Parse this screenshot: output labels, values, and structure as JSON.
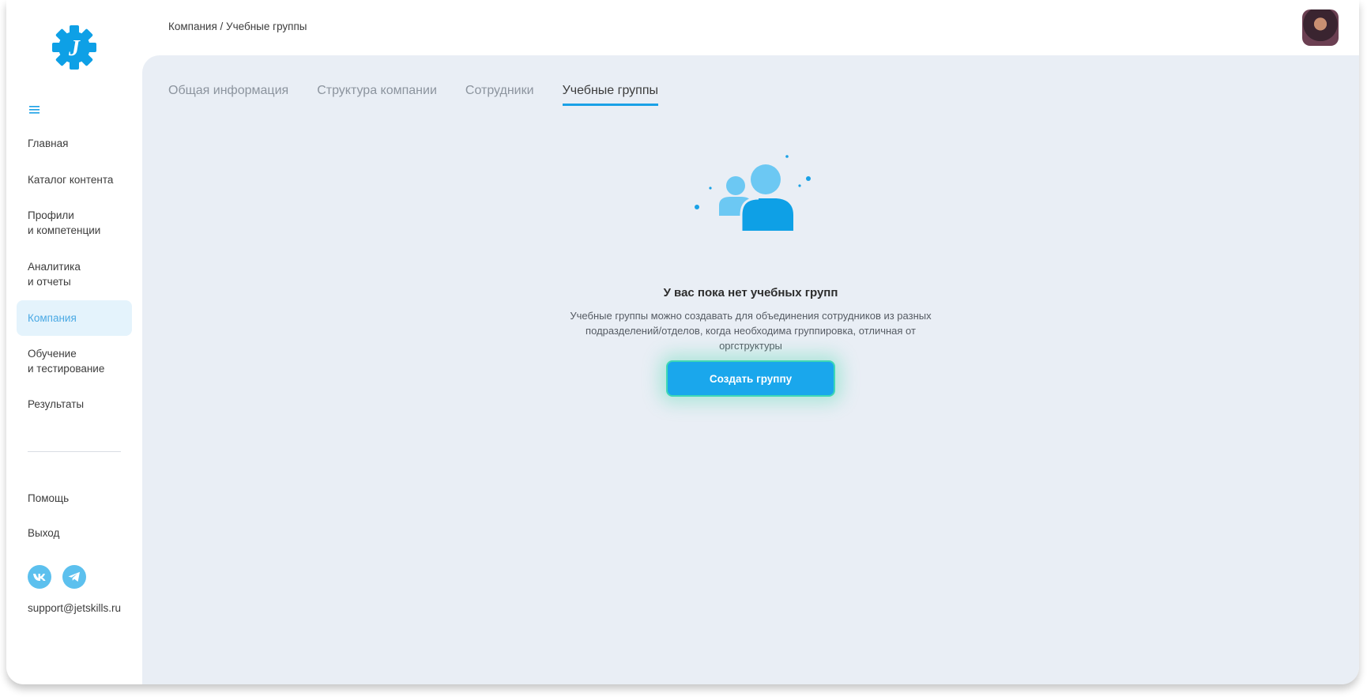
{
  "sidebar": {
    "logo_letter": "J",
    "items": [
      {
        "label": "Главная"
      },
      {
        "label": "Каталог контента"
      },
      {
        "label": "Профили\nи компетенции"
      },
      {
        "label": "Аналитика\nи отчеты"
      },
      {
        "label": "Компания",
        "active": true
      },
      {
        "label": "Обучение\nи тестирование"
      },
      {
        "label": "Результаты"
      }
    ],
    "bottom_items": [
      {
        "label": "Помощь"
      },
      {
        "label": "Выход"
      }
    ],
    "social": [
      {
        "icon": "vk-icon"
      },
      {
        "icon": "telegram-icon"
      }
    ],
    "support_email": "support@jetskills.ru"
  },
  "header": {
    "breadcrumb": "Компания / Учебные группы"
  },
  "main": {
    "tabs": [
      {
        "label": "Общая информация"
      },
      {
        "label": "Структура компании"
      },
      {
        "label": "Сотрудники"
      },
      {
        "label": "Учебные группы",
        "active": true
      }
    ],
    "empty_state": {
      "icon": "users-group-icon",
      "title": "У вас пока нет учебных групп",
      "description": "Учебные группы можно создавать для объединения сотрудников из разных подразделений/отделов, когда необходима группировка, отличная от оргструктуры",
      "button_label": "Создать группу"
    }
  },
  "colors": {
    "accent": "#1aa1e6",
    "active_bg": "#e4f3fc",
    "main_bg": "#e9eef5",
    "button_border": "#3fd7b5"
  }
}
